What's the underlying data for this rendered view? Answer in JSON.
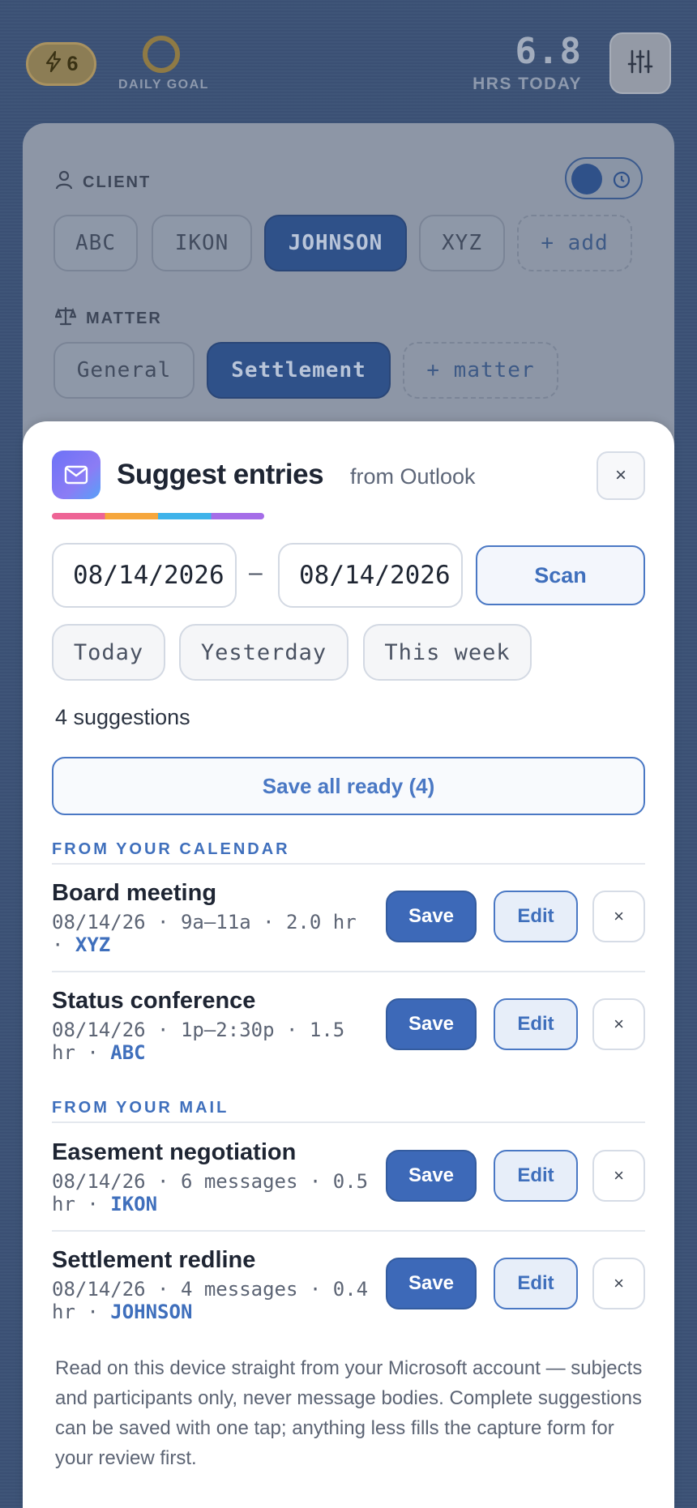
{
  "header": {
    "streak_count": "6",
    "goal_label": "DAILY GOAL",
    "hours_value": "6.8",
    "hours_label": "HRS TODAY",
    "colors": {
      "background": "#3c5276",
      "accent": "#3f6fbc"
    }
  },
  "capture": {
    "client_label": "CLIENT",
    "clients": [
      "ABC",
      "IKON",
      "JOHNSON",
      "XYZ"
    ],
    "selected_client": "JOHNSON",
    "add_client_label": "+ add",
    "matter_label": "MATTER",
    "matters": [
      "General",
      "Settlement"
    ],
    "selected_matter": "Settlement",
    "add_matter_label": "+ matter"
  },
  "sheet": {
    "title": "Suggest entries",
    "source": "from Outlook",
    "close_label": "×",
    "date_from": "08/14/2026",
    "date_to": "08/14/2026",
    "range_separator": "–",
    "scan_label": "Scan",
    "presets": [
      "Today",
      "Yesterday",
      "This week"
    ],
    "count_text": "4 suggestions",
    "save_all_label": "Save all ready (4)",
    "calendar_heading": "FROM YOUR CALENDAR",
    "mail_heading": "FROM YOUR MAIL",
    "save_label": "Save",
    "edit_label": "Edit",
    "dismiss_label": "×",
    "calendar_items": [
      {
        "title": "Board meeting",
        "meta": "08/14/26 · 9a–11a · 2.0 hr · ",
        "client": "XYZ"
      },
      {
        "title": "Status conference",
        "meta": "08/14/26 · 1p–2:30p · 1.5 hr · ",
        "client": "ABC"
      }
    ],
    "mail_items": [
      {
        "title": "Easement negotiation",
        "meta": "08/14/26 · 6 messages · 0.5 hr · ",
        "client": "IKON"
      },
      {
        "title": "Settlement redline",
        "meta": "08/14/26 · 4 messages · 0.4 hr · ",
        "client": "JOHNSON"
      }
    ],
    "footnote": "Read on this device straight from your Microsoft account — subjects and participants only, never message bodies. Complete suggestions can be saved with one tap; anything less fills the capture form for your review first."
  }
}
